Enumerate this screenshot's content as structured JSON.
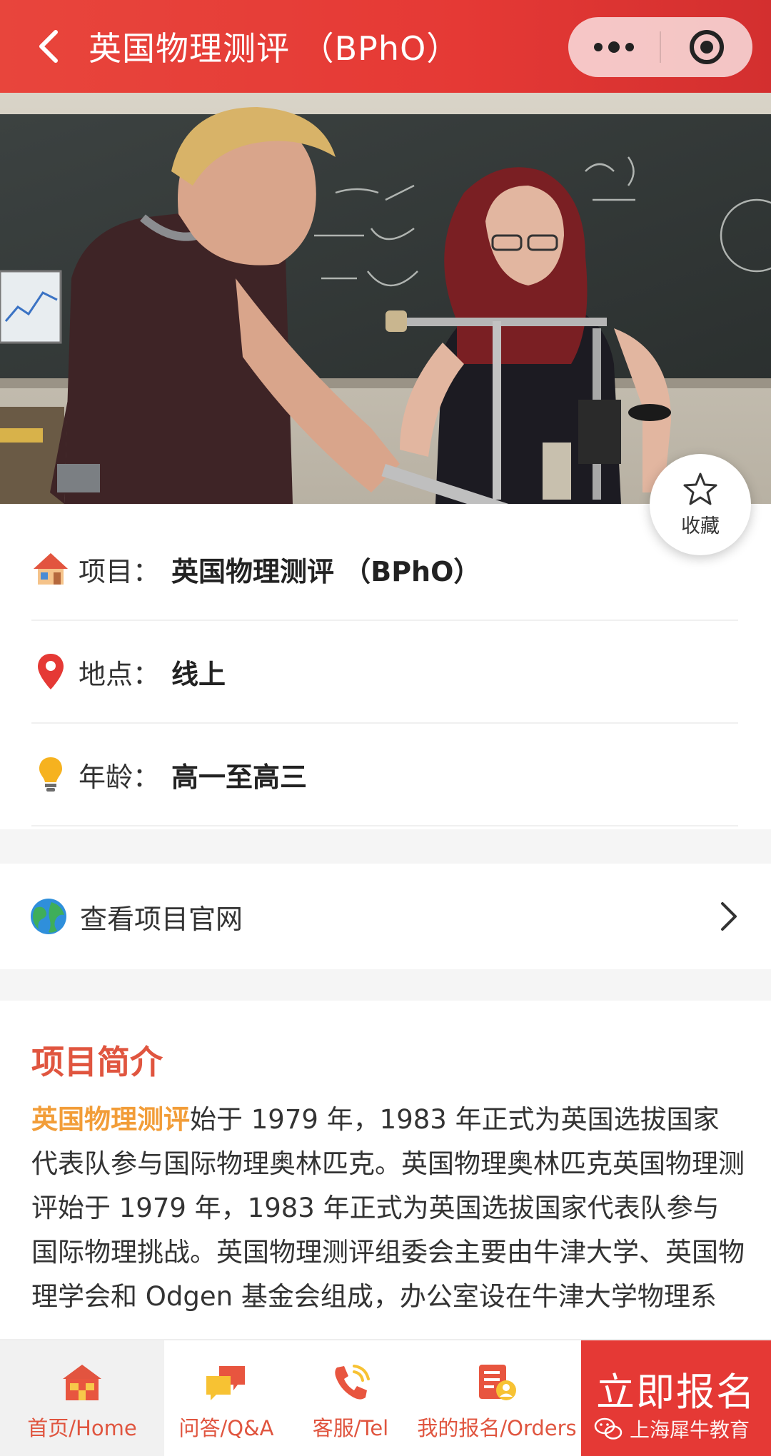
{
  "nav": {
    "title": "英国物理测评 （BPhO）"
  },
  "favorite": {
    "label": "收藏"
  },
  "info": {
    "project_label": "项目：",
    "project_value": "英国物理测评 （BPhO）",
    "location_label": "地点：",
    "location_value": "线上",
    "age_label": "年龄：",
    "age_value": "高一至高三"
  },
  "website": {
    "label": "查看项目官网"
  },
  "intro": {
    "title": "项目简介",
    "highlight": "英国物理测评",
    "text": "始于 1979 年，1983 年正式为英国选拔国家代表队参与国际物理奥林匹克。英国物理奥林匹克英国物理测评始于 1979 年，1983 年正式为英国选拔国家代表队参与国际物理挑战。英国物理测评组委会主要由牛津大学、英国物 理学会和 Odgen 基金会组成，办公室设在牛津大学物理系"
  },
  "tabbar": {
    "home": "首页/Home",
    "qa": "问答/Q&A",
    "tel": "客服/Tel",
    "orders": "我的报名/Orders",
    "signup": "立即报名",
    "watermark": "上海犀牛教育"
  },
  "colors": {
    "brand_red": "#e53935",
    "title_red": "#e0553f",
    "highlight_orange": "#f29d38"
  },
  "icons": [
    "back-arrow-icon",
    "more-dots-icon",
    "target-close-icon",
    "star-icon",
    "house-icon",
    "location-pin-icon",
    "lightbulb-icon",
    "globe-icon",
    "chevron-right-icon",
    "home-icon",
    "chat-bubbles-icon",
    "phone-icon",
    "checklist-user-icon",
    "wechat-icon"
  ]
}
